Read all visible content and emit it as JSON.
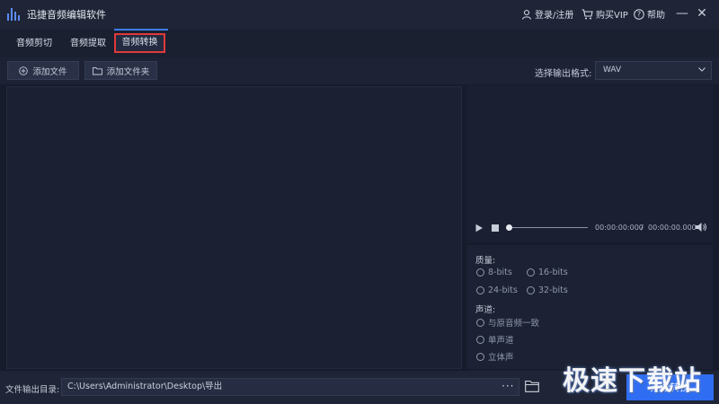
{
  "app": {
    "title": "迅捷音频编辑软件"
  },
  "titlebar": {
    "login": "登录/注册",
    "vip": "购买VIP",
    "help": "帮助",
    "minimize": "—",
    "close": "✕"
  },
  "tabs": [
    {
      "label": "音频剪切"
    },
    {
      "label": "音频提取"
    },
    {
      "label": "音频转换",
      "active": true
    }
  ],
  "toolbar": {
    "add_file": "添加文件",
    "add_folder": "添加文件夹",
    "format_label": "选择输出格式:",
    "format_value": "WAV"
  },
  "player": {
    "current_time": "00:00:00:000",
    "separator": "/",
    "total_time": "00:00:00.000",
    "progress": 0
  },
  "options": {
    "quality_label": "质量:",
    "quality": [
      "8-bits",
      "16-bits",
      "24-bits",
      "32-bits"
    ],
    "channel_label": "声道:",
    "channels": [
      "与原音频一致",
      "单声道",
      "立体声"
    ]
  },
  "bottom": {
    "output_label": "文件输出目录:",
    "output_path": "C:\\Users\\Administrator\\Desktop\\导出",
    "more": "···",
    "start": "开始转换"
  },
  "watermark": {
    "text": "极速下载站"
  },
  "colors": {
    "accent": "#2f6df2",
    "highlight": "#e03a3a",
    "background": "#171c2c"
  }
}
